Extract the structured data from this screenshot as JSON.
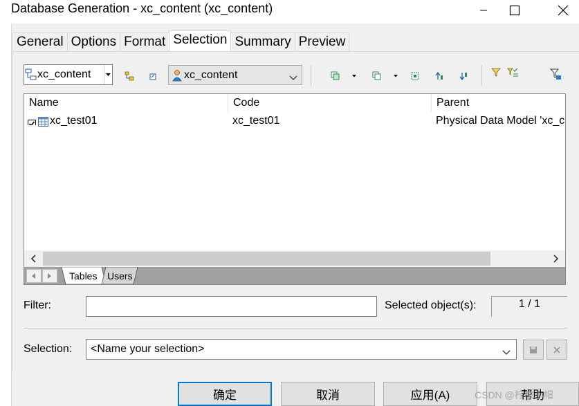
{
  "window": {
    "title": "Database Generation - xc_content (xc_content)"
  },
  "tabs": [
    {
      "label": "General"
    },
    {
      "label": "Options"
    },
    {
      "label": "Format"
    },
    {
      "label": "Selection"
    },
    {
      "label": "Summary"
    },
    {
      "label": "Preview"
    }
  ],
  "toolbar": {
    "model_combo_value": "xc_content",
    "owner_combo_value": "xc_content"
  },
  "list": {
    "columns": [
      "Name",
      "Code",
      "Parent"
    ],
    "rows": [
      {
        "checked": true,
        "name": "xc_test01",
        "code": "xc_test01",
        "parent": "Physical Data Model 'xc_co"
      }
    ],
    "sheet_tabs": [
      "Tables",
      "Users"
    ]
  },
  "filter": {
    "label": "Filter:",
    "value": ""
  },
  "selected_objects": {
    "label": "Selected object(s):",
    "count": "1 / 1"
  },
  "selection": {
    "label": "Selection:",
    "value": "<Name your selection>"
  },
  "buttons": {
    "ok": "确定",
    "cancel": "取消",
    "apply": "应用(A)",
    "help": "帮助"
  },
  "watermark": "CSDN @柠檬小帽"
}
